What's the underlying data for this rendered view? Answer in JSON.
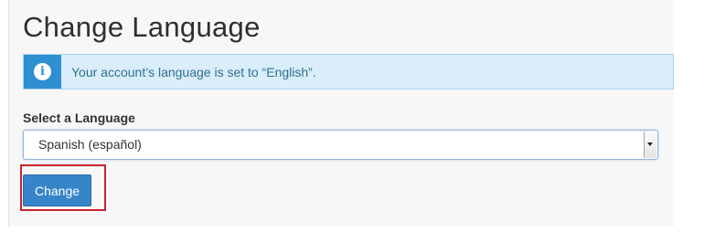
{
  "page": {
    "title": "Change Language"
  },
  "alert": {
    "icon": "info-icon",
    "icon_glyph": "i",
    "message": "Your account’s language is set to “English”.",
    "accent_color": "#2e8fd1",
    "background_color": "#d9eefa"
  },
  "language_form": {
    "label": "Select a Language",
    "selected_value": "Spanish (español)",
    "submit_label": "Change",
    "submit_color": "#3785c9",
    "highlight_color": "#c8232c"
  }
}
